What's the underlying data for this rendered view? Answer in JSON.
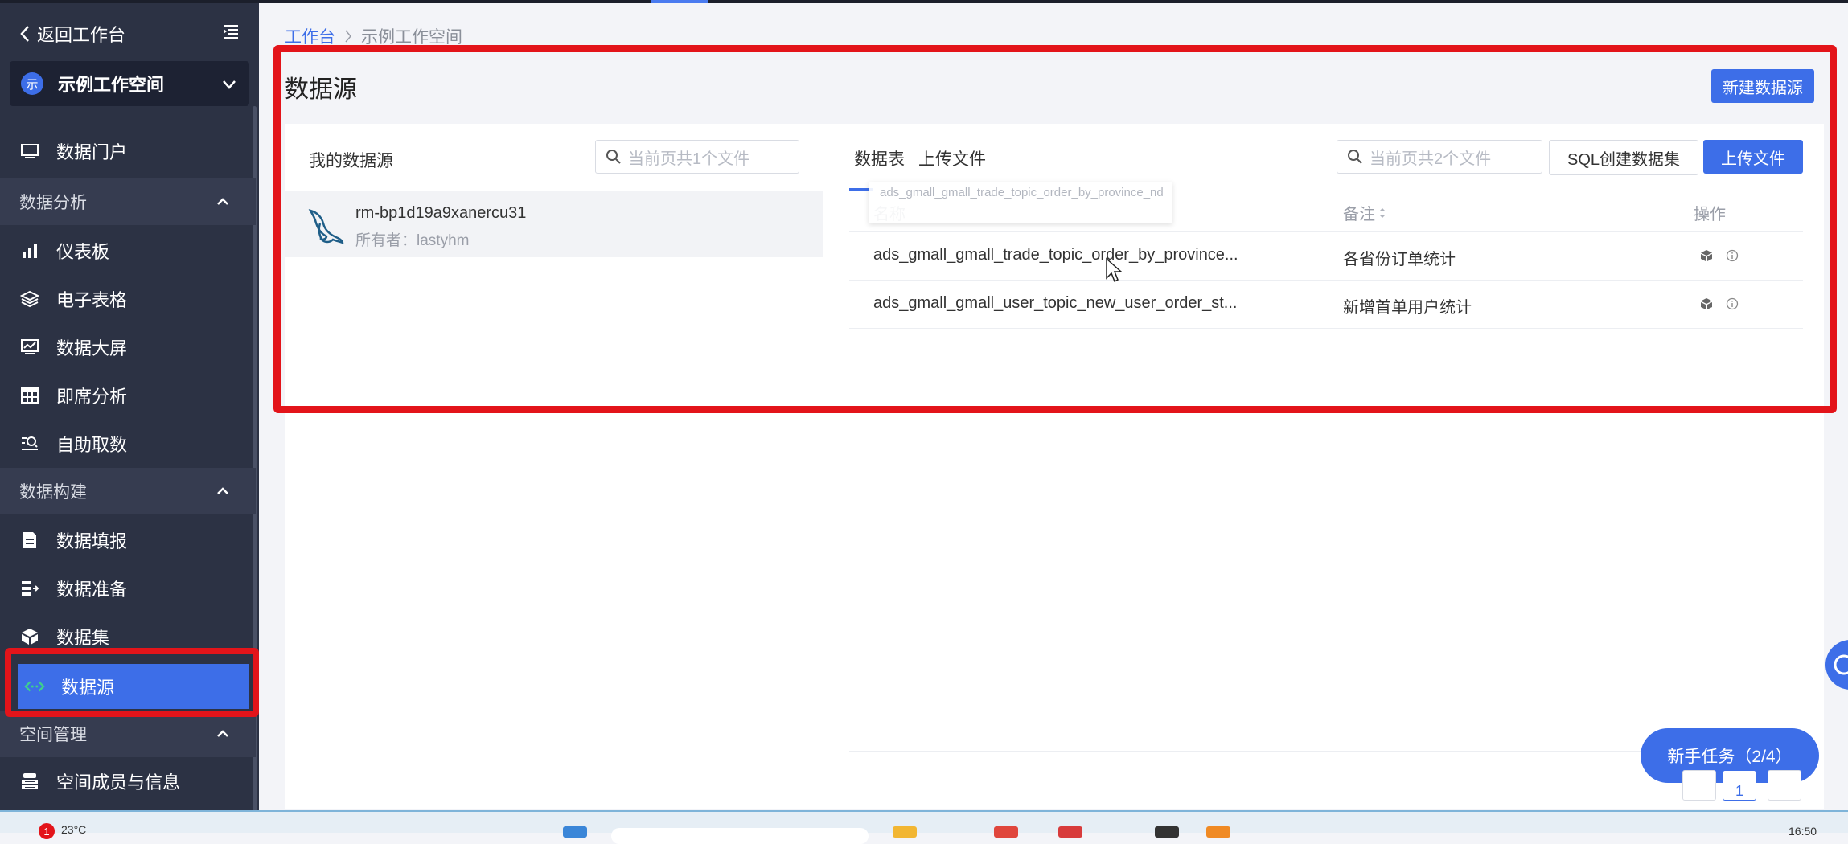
{
  "sidebar": {
    "back_label": "返回工作台",
    "workspace": {
      "avatar_text": "示",
      "name": "示例工作空间"
    },
    "items": [
      {
        "label": "数据门户"
      },
      {
        "label": "仪表板"
      },
      {
        "label": "电子表格"
      },
      {
        "label": "数据大屏"
      },
      {
        "label": "即席分析"
      },
      {
        "label": "自助取数"
      },
      {
        "label": "数据填报"
      },
      {
        "label": "数据准备"
      },
      {
        "label": "数据集"
      },
      {
        "label": "数据源"
      },
      {
        "label": "空间成员与信息"
      }
    ],
    "groups": [
      {
        "label": "数据分析"
      },
      {
        "label": "数据构建"
      },
      {
        "label": "空间管理"
      }
    ]
  },
  "breadcrumb": {
    "root": "工作台",
    "current": "示例工作空间"
  },
  "page": {
    "title": "数据源",
    "new_button": "新建数据源"
  },
  "left_panel": {
    "title": "我的数据源",
    "search_placeholder": "当前页共1个文件",
    "datasource": {
      "name": "rm-bp1d19a9xanercu31",
      "owner": "所有者：lastyhm"
    }
  },
  "right_panel": {
    "tabs": [
      "数据表",
      "上传文件"
    ],
    "search_placeholder": "当前页共2个文件",
    "sql_button": "SQL创建数据集",
    "upload_button": "上传文件",
    "columns": [
      "名称",
      "备注",
      "操作"
    ],
    "drag_ghost_text": "ads_gmall_gmall_trade_topic_order_by_province_nd",
    "rows": [
      {
        "name": "ads_gmall_gmall_trade_topic_order_by_province...",
        "note": "各省份订单统计"
      },
      {
        "name": "ads_gmall_gmall_user_topic_new_user_order_st...",
        "note": "新增首单用户统计"
      }
    ]
  },
  "tasks_button": "新手任务（2/4）",
  "pagination": {
    "current_page": "1"
  },
  "taskbar": {
    "weather": "23°C",
    "weather_badge": "1",
    "time": "16:50"
  },
  "colors": {
    "accent": "#3d6ee8",
    "sidebar": "#2c3244",
    "highlight": "#e3141a"
  }
}
